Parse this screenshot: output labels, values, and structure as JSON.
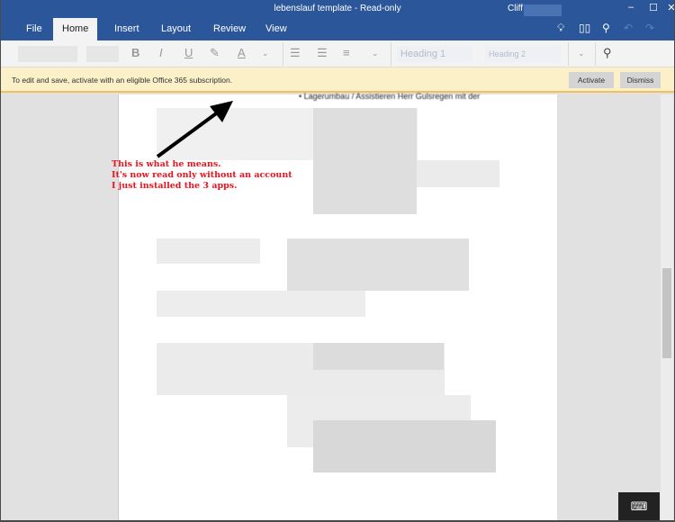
{
  "window": {
    "title": "lebenslauf template - Read-only",
    "user": "Cliff",
    "controls": [
      "–",
      "☐",
      "✕"
    ]
  },
  "tabs": [
    "File",
    "Home",
    "Insert",
    "Layout",
    "Review",
    "View"
  ],
  "active_tab": "Home",
  "ribbon": {
    "bold": "B",
    "italic": "I",
    "underline": "U",
    "font_color": "A",
    "heading1": "Heading 1",
    "heading2": "Heading 2"
  },
  "message_bar": {
    "text": "To edit and save, activate with an eligible Office 365 subscription.",
    "activate": "Activate",
    "dismiss": "Dismiss"
  },
  "document": {
    "bullet_text": "Lagerumbau / Assistieren Herr Gulsregen mit der"
  },
  "annotation": {
    "lines": [
      "This is what he means.",
      "It's now read only without an account",
      "I just installed the 3 apps."
    ],
    "color": "#e8141e"
  },
  "colors": {
    "titlebar": "#2b579a",
    "message_bar": "#fcf0c8"
  }
}
